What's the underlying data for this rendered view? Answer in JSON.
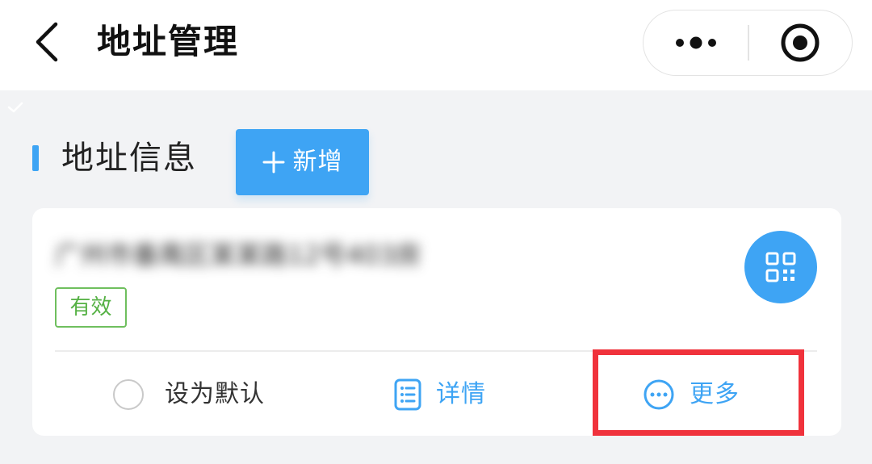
{
  "header": {
    "title": "地址管理"
  },
  "section": {
    "title": "地址信息",
    "add_label": "新增"
  },
  "card": {
    "address": "广州市番禺区某某路12号403房",
    "status": "有效",
    "actions": {
      "set_default": "设为默认",
      "details": "详情",
      "more": "更多"
    }
  },
  "colors": {
    "accent": "#3ea4f4",
    "status_green": "#55b144",
    "highlight_red": "#f0323c"
  },
  "icons": {
    "back": "chevron-left-icon",
    "capsule_more": "more-dots-icon",
    "capsule_close": "target-close-icon",
    "add": "plus-icon",
    "qr": "qr-code-icon",
    "details": "list-document-icon",
    "more": "more-circle-icon"
  }
}
